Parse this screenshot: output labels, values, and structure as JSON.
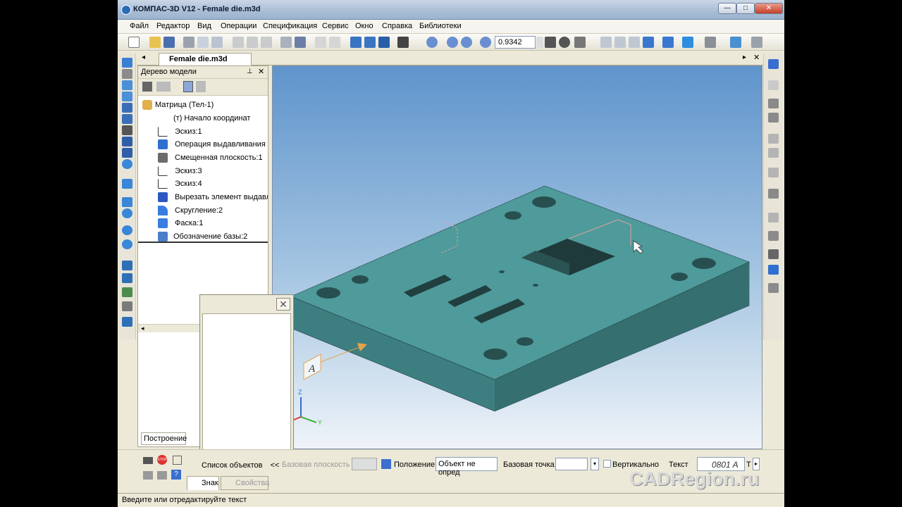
{
  "window": {
    "title": "КОМПАС-3D V12 - Female die.m3d",
    "min_label": "—",
    "max_label": "□",
    "close_label": "✕"
  },
  "menu": [
    "Файл",
    "Редактор",
    "Вид",
    "Операции",
    "Спецификация",
    "Сервис",
    "Окно",
    "Справка",
    "Библиотеки"
  ],
  "toolbar": {
    "zoom_value": "0.9342"
  },
  "document_tab": {
    "label": "Female die.m3d"
  },
  "tree": {
    "header": "Дерево модели",
    "items": [
      {
        "label": "Матрица (Тел-1)",
        "icon": "part-icon",
        "indent": 0
      },
      {
        "label": "(т) Начало координат",
        "icon": "origin-icon",
        "indent": 1
      },
      {
        "label": "Эскиз:1",
        "icon": "sketch-icon",
        "indent": 1
      },
      {
        "label": "Операция выдавливания",
        "icon": "extrude-icon",
        "indent": 1
      },
      {
        "label": "Смещенная плоскость:1",
        "icon": "plane-icon",
        "indent": 1
      },
      {
        "label": "Эскиз:3",
        "icon": "sketch-icon",
        "indent": 1
      },
      {
        "label": "Эскиз:4",
        "icon": "sketch-icon",
        "indent": 1
      },
      {
        "label": "Вырезать элемент выдавл",
        "icon": "cut-extrude-icon",
        "indent": 1
      },
      {
        "label": "Скругление:2",
        "icon": "fillet-icon",
        "indent": 1
      },
      {
        "label": "Фаска:1",
        "icon": "chamfer-icon",
        "indent": 1
      },
      {
        "label": "Обозначение базы:2",
        "icon": "datum-icon",
        "indent": 1
      }
    ],
    "build_tab": "Построение"
  },
  "properties": {
    "object_list": "Список объектов",
    "object_list_toggle": "<<",
    "base_plane": "Базовая плоскость",
    "position": "Положение",
    "object_undefined": "Объект не опред",
    "base_point": "Базовая точка",
    "vertical": "Вертикально",
    "text_label": "Текст",
    "text_value": "0801 A",
    "text_suffix": "Т"
  },
  "bottom_tabs": [
    "Знак",
    "Свойства"
  ],
  "status": "Введите или отредактируйте текст",
  "watermark": "CADRegion.ru",
  "viewport": {
    "datum_letter": "A",
    "axis_z": "Z",
    "axis_y": "Y"
  },
  "colors": {
    "part_top": "#4f9a9a",
    "part_side": "#3d7f80",
    "viewport_top": "#5f94cc",
    "viewport_bottom": "#eef3f8",
    "datum": "#e8a24a"
  }
}
